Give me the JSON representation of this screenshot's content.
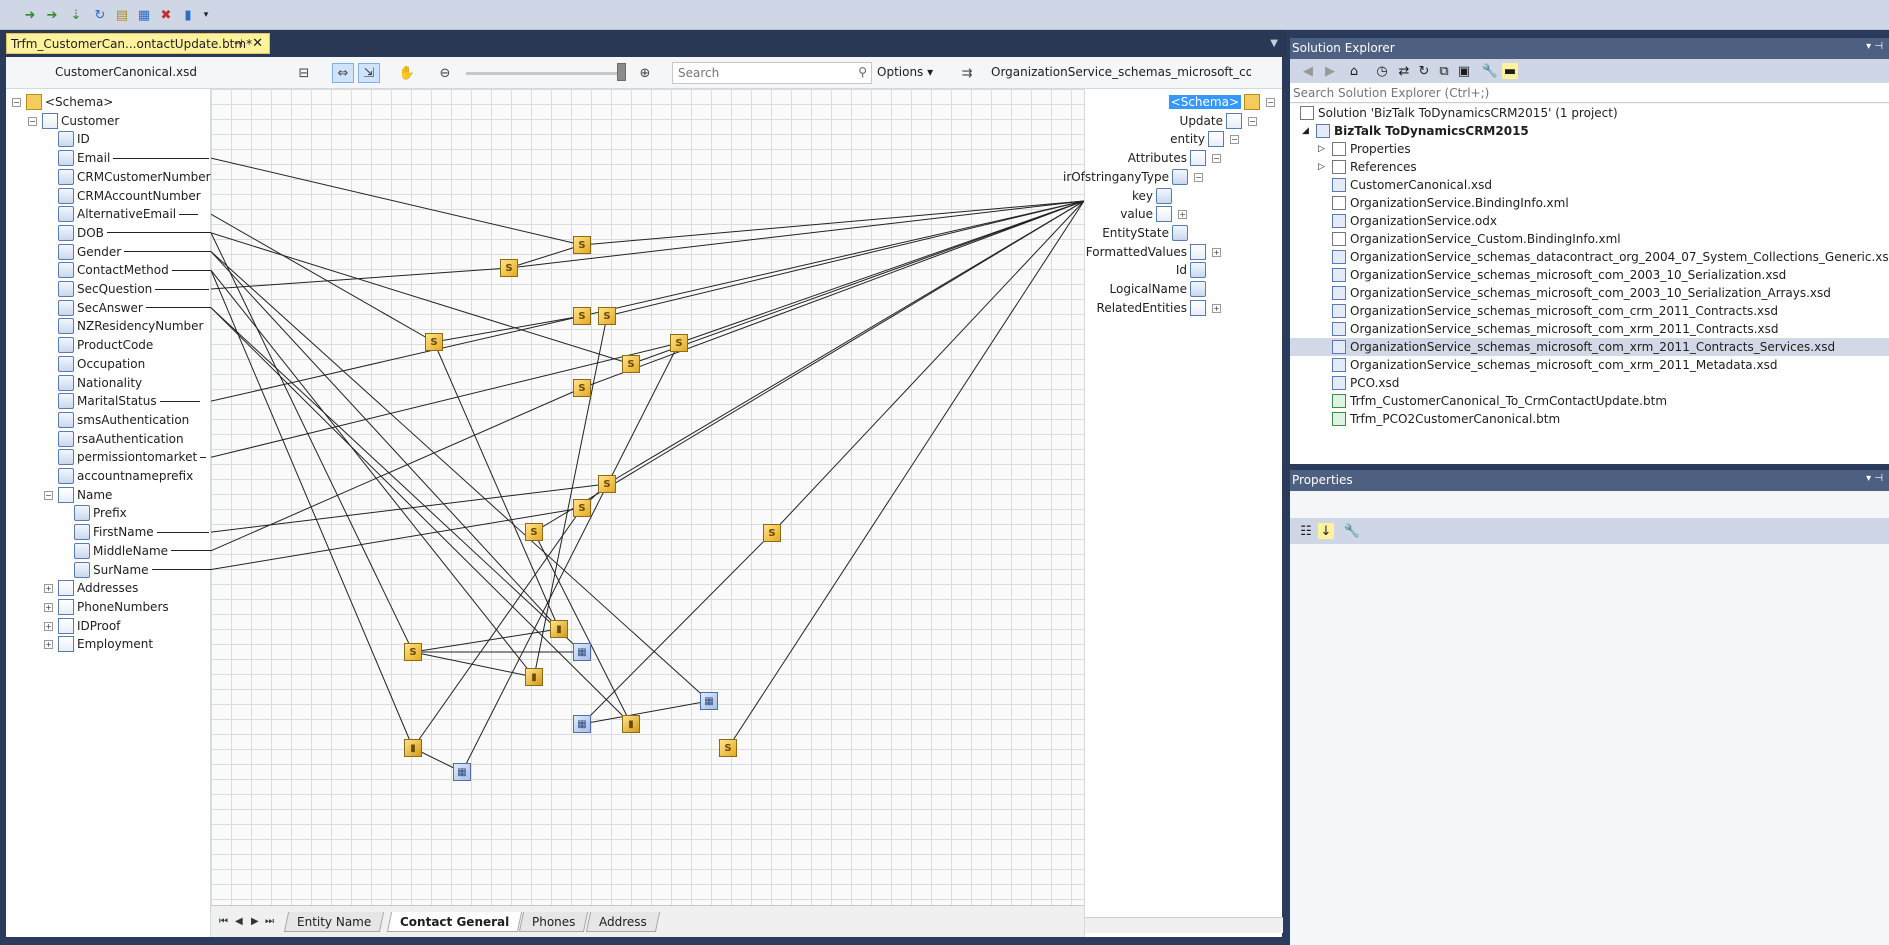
{
  "document_tab": {
    "title": "Trfm_CustomerCan...ontactUpdate.btm*",
    "pin_icon": "pin-icon",
    "close_icon": "close-icon"
  },
  "mapper_toolbar": {
    "source_title": "CustomerCanonical.xsd",
    "search_placeholder": "Search",
    "options_label": "Options",
    "dest_title": "OrganizationService_schemas_microsoft_com..."
  },
  "source_tree": [
    {
      "label": "<Schema>",
      "depth": 0,
      "icon": "folder",
      "exp": "−"
    },
    {
      "label": "Customer",
      "depth": 1,
      "icon": "rec",
      "exp": "−"
    },
    {
      "label": "ID",
      "depth": 2,
      "icon": "fld"
    },
    {
      "label": "Email",
      "depth": 2,
      "icon": "fld",
      "linked": true
    },
    {
      "label": "CRMCustomerNumber",
      "depth": 2,
      "icon": "fld"
    },
    {
      "label": "CRMAccountNumber",
      "depth": 2,
      "icon": "fld"
    },
    {
      "label": "AlternativeEmail",
      "depth": 2,
      "icon": "fld",
      "linked": true
    },
    {
      "label": "DOB",
      "depth": 2,
      "icon": "fld",
      "linked": true
    },
    {
      "label": "Gender",
      "depth": 2,
      "icon": "fld",
      "linked": true
    },
    {
      "label": "ContactMethod",
      "depth": 2,
      "icon": "fld",
      "linked": true
    },
    {
      "label": "SecQuestion",
      "depth": 2,
      "icon": "fld",
      "linked": true
    },
    {
      "label": "SecAnswer",
      "depth": 2,
      "icon": "fld",
      "linked": true
    },
    {
      "label": "NZResidencyNumber",
      "depth": 2,
      "icon": "fld"
    },
    {
      "label": "ProductCode",
      "depth": 2,
      "icon": "fld"
    },
    {
      "label": "Occupation",
      "depth": 2,
      "icon": "fld"
    },
    {
      "label": "Nationality",
      "depth": 2,
      "icon": "fld"
    },
    {
      "label": "MaritalStatus",
      "depth": 2,
      "icon": "fld",
      "linked": true
    },
    {
      "label": "smsAuthentication",
      "depth": 2,
      "icon": "fld"
    },
    {
      "label": "rsaAuthentication",
      "depth": 2,
      "icon": "fld"
    },
    {
      "label": "permissiontomarket",
      "depth": 2,
      "icon": "fld",
      "linked": true
    },
    {
      "label": "accountnameprefix",
      "depth": 2,
      "icon": "fld"
    },
    {
      "label": "Name",
      "depth": 2,
      "icon": "rec",
      "exp": "−"
    },
    {
      "label": "Prefix",
      "depth": 3,
      "icon": "fld"
    },
    {
      "label": "FirstName",
      "depth": 3,
      "icon": "fld",
      "linked": true
    },
    {
      "label": "MiddleName",
      "depth": 3,
      "icon": "fld",
      "linked": true
    },
    {
      "label": "SurName",
      "depth": 3,
      "icon": "fld",
      "linked": true
    },
    {
      "label": "Addresses",
      "depth": 2,
      "icon": "rec",
      "exp": "+"
    },
    {
      "label": "PhoneNumbers",
      "depth": 2,
      "icon": "rec",
      "exp": "+"
    },
    {
      "label": "IDProof",
      "depth": 2,
      "icon": "rec",
      "exp": "+"
    },
    {
      "label": "Employment",
      "depth": 2,
      "icon": "rec",
      "exp": "+"
    }
  ],
  "dest_tree": [
    {
      "label": "<Schema>",
      "icon": "folder",
      "exp": "−",
      "selected": true
    },
    {
      "label": "Update",
      "icon": "rec",
      "exp": "−"
    },
    {
      "label": "entity",
      "icon": "rec",
      "exp": "−"
    },
    {
      "label": "Attributes",
      "icon": "rec",
      "exp": "−"
    },
    {
      "label": "irOfstringanyType",
      "icon": "fld",
      "exp": "−"
    },
    {
      "label": "key",
      "icon": "fld"
    },
    {
      "label": "value",
      "icon": "rec",
      "exp": "+"
    },
    {
      "label": "EntityState",
      "icon": "fld"
    },
    {
      "label": "FormattedValues",
      "icon": "rec",
      "exp": "+"
    },
    {
      "label": "Id",
      "icon": "fld"
    },
    {
      "label": "LogicalName",
      "icon": "fld"
    },
    {
      "label": "RelatedEntities",
      "icon": "rec",
      "exp": "+"
    }
  ],
  "page_tabs": [
    {
      "label": "Entity Name",
      "active": false
    },
    {
      "label": "Contact General",
      "active": true
    },
    {
      "label": "Phones",
      "active": false
    },
    {
      "label": "Address",
      "active": false
    }
  ],
  "solution_explorer": {
    "title": "Solution Explorer",
    "search_placeholder": "Search Solution Explorer (Ctrl+;)",
    "items": [
      {
        "label": "Solution 'BizTalk ToDynamicsCRM2015' (1 project)",
        "indent": 0,
        "icon": "file",
        "bold": false
      },
      {
        "label": "BizTalk ToDynamicsCRM2015",
        "indent": 1,
        "icon": "proj",
        "bold": true,
        "exp": "◢"
      },
      {
        "label": "Properties",
        "indent": 2,
        "icon": "file",
        "exp": "▷"
      },
      {
        "label": "References",
        "indent": 2,
        "icon": "file",
        "exp": "▷"
      },
      {
        "label": "CustomerCanonical.xsd",
        "indent": 2,
        "icon": "xsd"
      },
      {
        "label": "OrganizationService.BindingInfo.xml",
        "indent": 2,
        "icon": "file"
      },
      {
        "label": "OrganizationService.odx",
        "indent": 2,
        "icon": "xsd"
      },
      {
        "label": "OrganizationService_Custom.BindingInfo.xml",
        "indent": 2,
        "icon": "file"
      },
      {
        "label": "OrganizationService_schemas_datacontract_org_2004_07_System_Collections_Generic.xsd",
        "indent": 2,
        "icon": "xsd"
      },
      {
        "label": "OrganizationService_schemas_microsoft_com_2003_10_Serialization.xsd",
        "indent": 2,
        "icon": "xsd"
      },
      {
        "label": "OrganizationService_schemas_microsoft_com_2003_10_Serialization_Arrays.xsd",
        "indent": 2,
        "icon": "xsd"
      },
      {
        "label": "OrganizationService_schemas_microsoft_com_crm_2011_Contracts.xsd",
        "indent": 2,
        "icon": "xsd"
      },
      {
        "label": "OrganizationService_schemas_microsoft_com_xrm_2011_Contracts.xsd",
        "indent": 2,
        "icon": "xsd"
      },
      {
        "label": "OrganizationService_schemas_microsoft_com_xrm_2011_Contracts_Services.xsd",
        "indent": 2,
        "icon": "xsd",
        "selected": true
      },
      {
        "label": "OrganizationService_schemas_microsoft_com_xrm_2011_Metadata.xsd",
        "indent": 2,
        "icon": "xsd"
      },
      {
        "label": "PCO.xsd",
        "indent": 2,
        "icon": "xsd"
      },
      {
        "label": "Trfm_CustomerCanonical_To_CrmContactUpdate.btm",
        "indent": 2,
        "icon": "btm"
      },
      {
        "label": "Trfm_PCO2CustomerCanonical.btm",
        "indent": 2,
        "icon": "btm"
      }
    ]
  },
  "properties": {
    "title": "Properties"
  },
  "colors": {
    "tab_active": "#fff29d",
    "pane_title": "#4d6082",
    "chrome": "#2b3b5c",
    "functoid": "#e5a923"
  }
}
